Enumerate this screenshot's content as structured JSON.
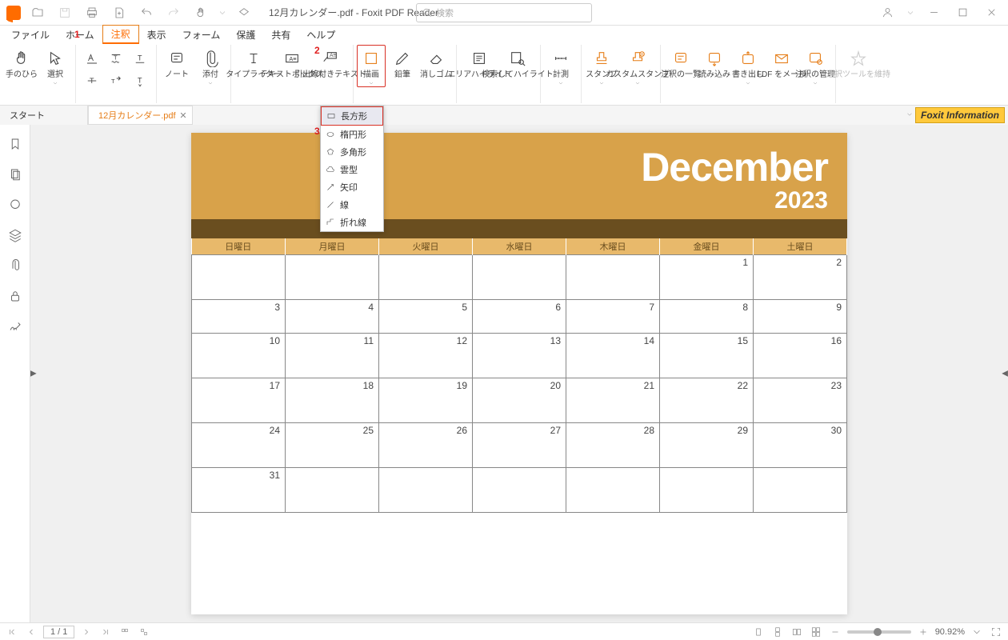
{
  "app": {
    "title": "12月カレンダー.pdf - Foxit PDF Reader"
  },
  "search": {
    "placeholder": "検索"
  },
  "menubar": [
    "ファイル",
    "ホーム",
    "注釈",
    "表示",
    "フォーム",
    "保護",
    "共有",
    "ヘルプ"
  ],
  "callouts": {
    "c1": "1",
    "c2": "2",
    "c3": "3"
  },
  "ribbon": {
    "hand": "手のひら",
    "select": "選択",
    "note": "ノート",
    "attach": "添付",
    "typewriter": "タイプライター",
    "textbox": "テキストボックス",
    "callout": "引出線付きテキスト",
    "draw": "描画",
    "pencil": "鉛筆",
    "eraser": "消しゴム",
    "areaHL": "エリアハイライト",
    "searchHL": "検索してハイライト",
    "measure": "計測",
    "stamp": "スタンプ",
    "customStamp": "カスタムスタンプ",
    "annotList": "注釈の一覧",
    "import": "読み込み",
    "export": "書き出し",
    "fdfMail": "FDF をメール",
    "manage": "注釈の管理",
    "keepTool": "選択ツールを維持"
  },
  "tabs": {
    "start": "スタート",
    "doc": "12月カレンダー.pdf"
  },
  "info_badge": "Foxit Information",
  "dropdown": [
    "長方形",
    "楕円形",
    "多角形",
    "雲型",
    "矢印",
    "線",
    "折れ線"
  ],
  "calendar": {
    "month": "December",
    "year": "2023",
    "weekdays": [
      "日曜日",
      "月曜日",
      "火曜日",
      "水曜日",
      "木曜日",
      "金曜日",
      "土曜日"
    ],
    "rows": [
      [
        "",
        "",
        "",
        "",
        "",
        "1",
        "2"
      ],
      [
        "3",
        "4",
        "5",
        "6",
        "7",
        "8",
        "9"
      ],
      [
        "10",
        "11",
        "12",
        "13",
        "14",
        "15",
        "16"
      ],
      [
        "17",
        "18",
        "19",
        "20",
        "21",
        "22",
        "23"
      ],
      [
        "24",
        "25",
        "26",
        "27",
        "28",
        "29",
        "30"
      ],
      [
        "31",
        "",
        "",
        "",
        "",
        "",
        ""
      ]
    ]
  },
  "status": {
    "page": "1 / 1",
    "zoom": "90.92%"
  }
}
